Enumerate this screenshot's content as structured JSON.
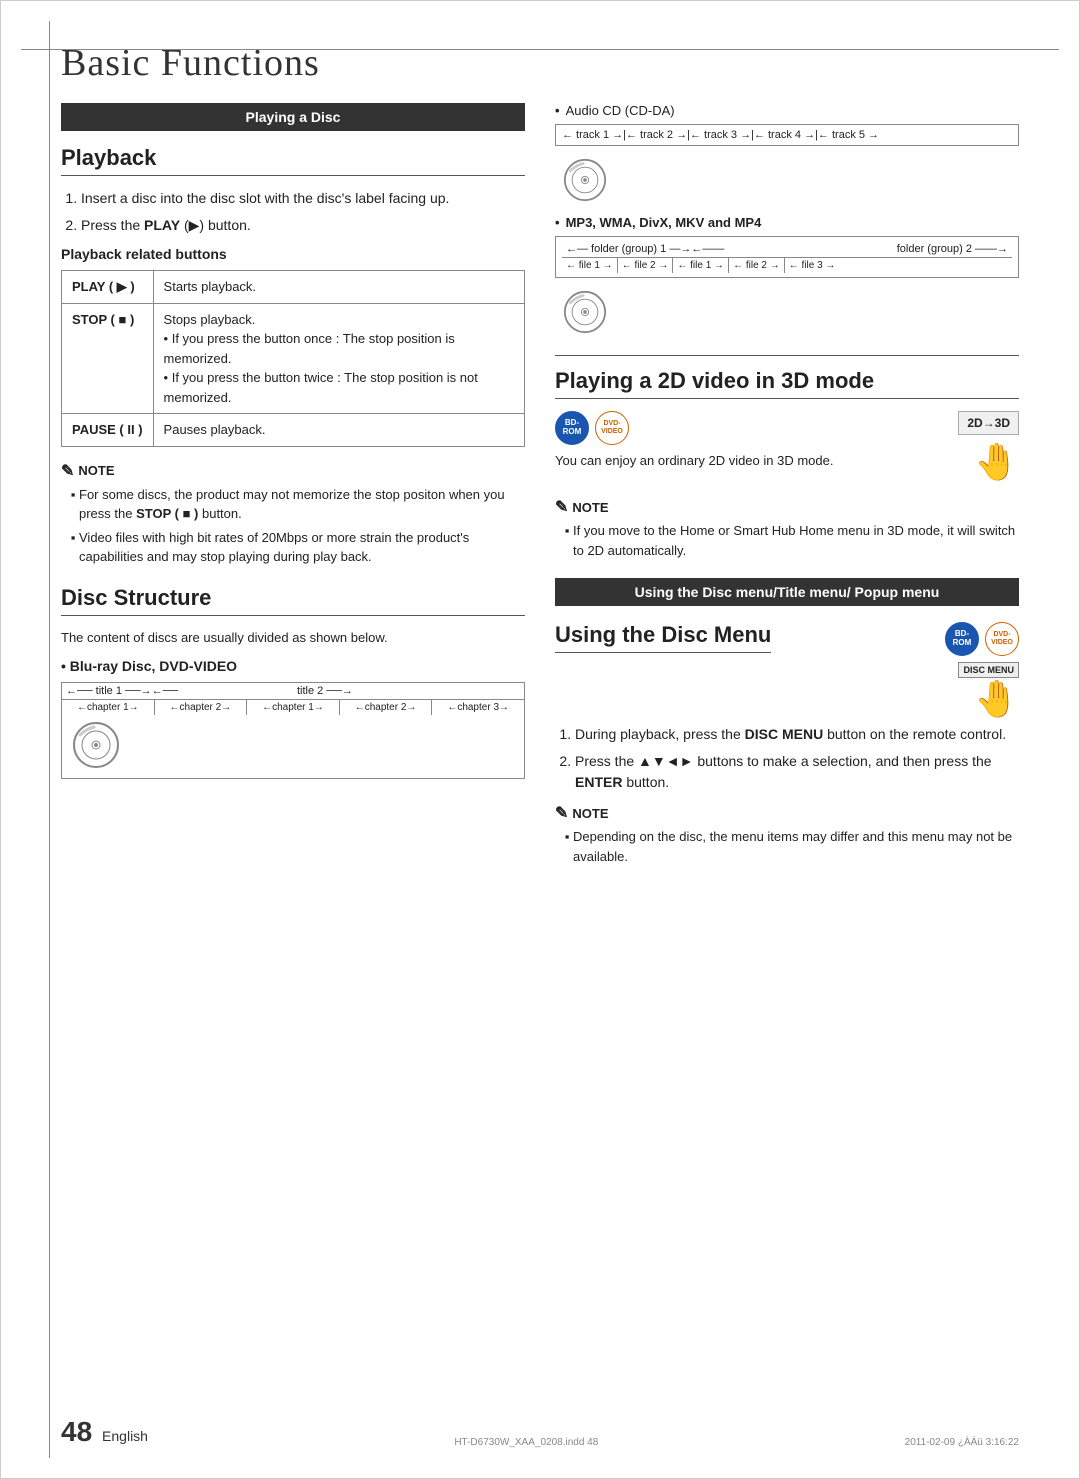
{
  "page": {
    "title": "Basic Functions",
    "left_section1": {
      "band_header": "Playing a Disc",
      "playback_title": "Playback",
      "steps": [
        "Insert a disc into the disc slot with the disc's label facing up.",
        "Press the PLAY (▶) button."
      ],
      "playback_buttons_title": "Playback related buttons",
      "buttons_table": [
        {
          "button": "PLAY ( ▶ )",
          "description": "Starts playback."
        },
        {
          "button": "STOP ( ■ )",
          "description": "Stops playback.\n• If you press the button once : The stop position is memorized.\n• If you press the button twice : The stop position is not memorized."
        },
        {
          "button": "PAUSE ( II )",
          "description": "Pauses playback."
        }
      ],
      "note_title": "NOTE",
      "notes": [
        "For some discs, the product may not memorize the stop positon when you press the STOP ( ■ ) button.",
        "Video files with high bit rates of 20Mbps or more strain the product's capabilities and may stop playing during play back."
      ]
    },
    "left_section2": {
      "disc_structure_title": "Disc Structure",
      "disc_structure_body": "The content of discs are usually divided as shown below.",
      "blu_ray_label": "Blu-ray Disc, DVD-VIDEO",
      "titles_row": [
        "title 1",
        "title 2"
      ],
      "chapters_row": [
        "chapter 1",
        "chapter 2",
        "chapter 1",
        "chapter 2",
        "chapter 3"
      ]
    },
    "right_section1": {
      "audio_cd_label": "Audio CD (CD-DA)",
      "tracks": [
        "track 1",
        "track 2",
        "track 3",
        "track 4",
        "track 5"
      ],
      "mp3_label": "MP3, WMA, DivX, MKV and MP4",
      "folder_groups": [
        "folder (group) 1",
        "folder (group) 2"
      ],
      "files_row": [
        "file 1",
        "file 2",
        "file 1",
        "file 2",
        "file 3"
      ]
    },
    "right_section2": {
      "title": "Playing a 2D video in 3D mode",
      "bd_rom_label": "BD-ROM",
      "dvd_video_label": "DVD-VIDEO",
      "mode_label": "2D→3D",
      "body": "You can enjoy an ordinary 2D video in 3D mode.",
      "note_title": "NOTE",
      "notes": [
        "If you move to the Home or Smart Hub Home menu in 3D mode, it will switch to 2D automatically."
      ]
    },
    "right_section3": {
      "band_header": "Using the Disc menu/Title menu/ Popup menu",
      "using_disc_title": "Using the Disc Menu",
      "bd_rom_label": "BD-ROM",
      "dvd_video_label": "DVD-VIDEO",
      "disc_menu_label": "DISC MENU",
      "steps": [
        "During playback, press the DISC MENU button on the remote control.",
        "Press the ▲▼◄► buttons to make a selection, and then press the ENTER button."
      ],
      "note_title": "NOTE",
      "notes": [
        "Depending on the disc, the menu items may differ and this menu may not be available."
      ]
    }
  },
  "footer": {
    "page_number": "48",
    "language": "English",
    "file_name": "HT-D6730W_XAA_0208.indd  48",
    "date": "2011-02-09  ¿ÀÀü 3:16:22"
  }
}
